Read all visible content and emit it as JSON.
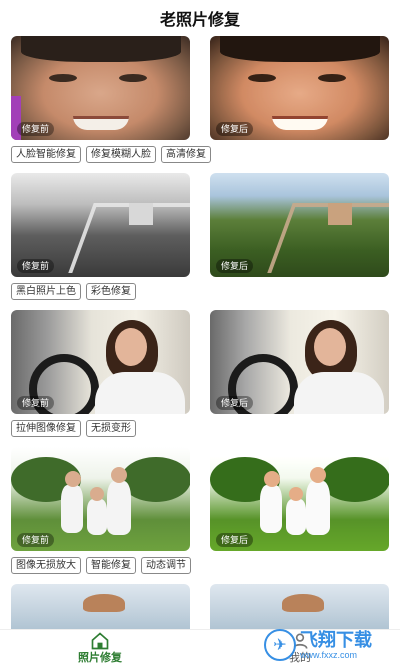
{
  "header": {
    "title": "老照片修复"
  },
  "sections": [
    {
      "before_badge": "修复前",
      "after_badge": "修复后",
      "tags": [
        "人脸智能修复",
        "修复模糊人脸",
        "高清修复"
      ]
    },
    {
      "before_badge": "修复前",
      "after_badge": "修复后",
      "tags": [
        "黑白照片上色",
        "彩色修复"
      ]
    },
    {
      "before_badge": "修复前",
      "after_badge": "修复后",
      "tags": [
        "拉伸图像修复",
        "无损变形"
      ]
    },
    {
      "before_badge": "修复前",
      "after_badge": "修复后",
      "tags": [
        "图像无损放大",
        "智能修复",
        "动态调节"
      ]
    }
  ],
  "bottom_nav": {
    "items": [
      {
        "label": "照片修复",
        "icon": "home-icon",
        "active": true
      },
      {
        "label": "我的",
        "icon": "user-icon",
        "active": false
      }
    ]
  },
  "watermark": {
    "title": "飞翔下载",
    "url": "www.fxxz.com"
  },
  "colors": {
    "accent": "#2e7d32",
    "watermark": "#2d8ae3"
  }
}
